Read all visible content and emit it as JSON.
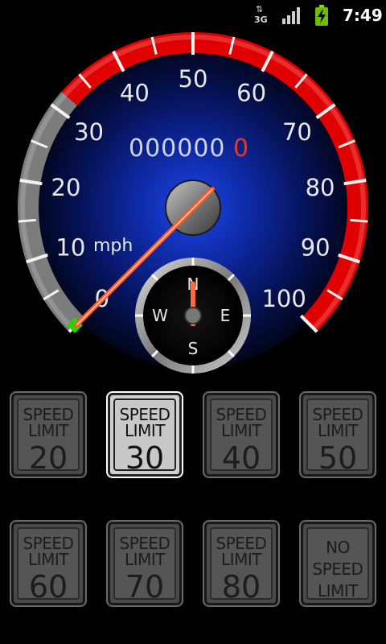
{
  "status_bar": {
    "network_label": "3G",
    "network_arrows": "⇅",
    "signal_icon": "signal-bars-icon",
    "battery_icon": "battery-charging-icon",
    "time": "7:49"
  },
  "speedometer": {
    "unit": "mph",
    "odometer_digits": "000000",
    "odometer_last_digit": "0",
    "scale_labels": [
      "0",
      "10",
      "20",
      "30",
      "40",
      "50",
      "60",
      "70",
      "80",
      "90",
      "100"
    ],
    "current_speed": 0,
    "colors": {
      "danger_arc": "#e10000",
      "safe_arc": "#7c7c7c",
      "dial_center": "#0a2db4",
      "needle": "#ff5a2a",
      "zero_marker": "#27d500"
    }
  },
  "compass": {
    "n": "N",
    "e": "E",
    "s": "S",
    "w": "W"
  },
  "speed_limits": [
    {
      "line1": "SPEED",
      "line2": "LIMIT",
      "value": "20",
      "selected": false
    },
    {
      "line1": "SPEED",
      "line2": "LIMIT",
      "value": "30",
      "selected": true
    },
    {
      "line1": "SPEED",
      "line2": "LIMIT",
      "value": "40",
      "selected": false
    },
    {
      "line1": "SPEED",
      "line2": "LIMIT",
      "value": "50",
      "selected": false
    },
    {
      "line1": "SPEED",
      "line2": "LIMIT",
      "value": "60",
      "selected": false
    },
    {
      "line1": "SPEED",
      "line2": "LIMIT",
      "value": "70",
      "selected": false
    },
    {
      "line1": "SPEED",
      "line2": "LIMIT",
      "value": "80",
      "selected": false
    }
  ],
  "no_limit": {
    "line1": "NO",
    "line2": "SPEED",
    "line3": "LIMIT"
  }
}
